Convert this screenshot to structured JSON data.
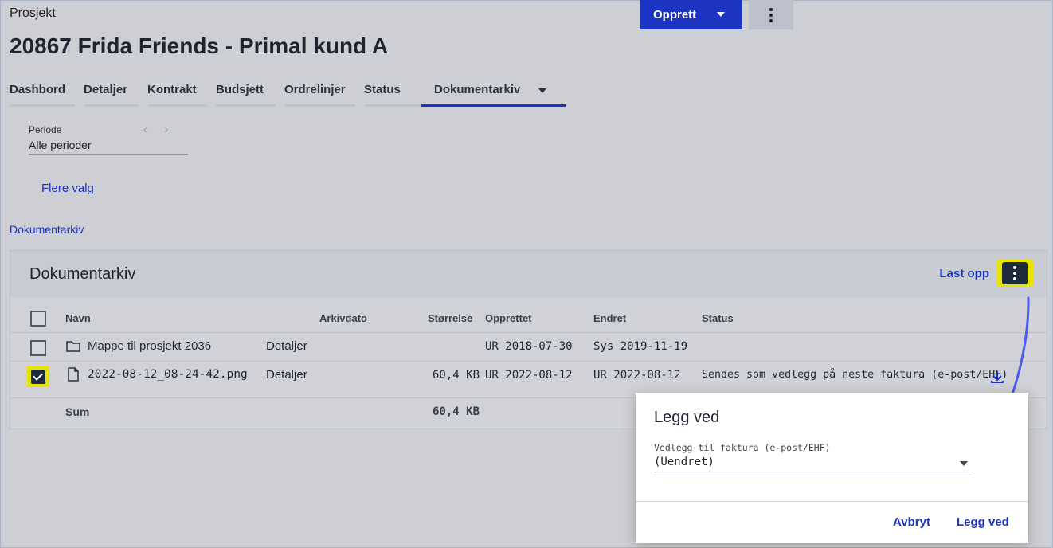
{
  "breadcrumb": "Prosjekt",
  "header": {
    "create_label": "Opprett",
    "title": "20867 Frida Friends - Primal kund A"
  },
  "tabs": [
    {
      "label": "Dashbord"
    },
    {
      "label": "Detaljer"
    },
    {
      "label": "Kontrakt"
    },
    {
      "label": "Budsjett"
    },
    {
      "label": "Ordrelinjer"
    },
    {
      "label": "Status"
    },
    {
      "label": "Dokumentarkiv",
      "active": true
    }
  ],
  "filter": {
    "periode_label": "Periode",
    "periode_value": "Alle perioder",
    "more_options": "Flere valg"
  },
  "breadcrumb_link": "Dokumentarkiv",
  "archive": {
    "title": "Dokumentarkiv",
    "upload_label": "Last opp",
    "columns": [
      "Navn",
      "Arkivdato",
      "Størrelse",
      "Opprettet",
      "Endret",
      "Status"
    ],
    "rows": [
      {
        "name": "Mappe til prosjekt 2036",
        "type": "folder",
        "details": "Detaljer",
        "arkivdato": "",
        "size": "",
        "created": "UR 2018-07-30",
        "changed": "Sys 2019-11-19",
        "status": "",
        "checked": false
      },
      {
        "name": "2022-08-12_08-24-42.png",
        "type": "file",
        "details": "Detaljer",
        "arkivdato": "",
        "size": "60,4 KB",
        "created": "UR 2022-08-12",
        "changed": "UR 2022-08-12",
        "status": "Sendes som vedlegg på neste faktura (e-post/EHF)",
        "checked": true
      }
    ],
    "sum_label": "Sum",
    "sum_size": "60,4 KB"
  },
  "dialog": {
    "title": "Legg ved",
    "field_label": "Vedlegg til faktura (e-post/EHF)",
    "field_value": "(Uendret)",
    "cancel_label": "Avbryt",
    "confirm_label": "Legg ved"
  },
  "colors": {
    "primary": "#1c34c2",
    "highlight": "#e8e400",
    "dark": "#1d2a3c",
    "arrow": "#4a5cf0"
  }
}
